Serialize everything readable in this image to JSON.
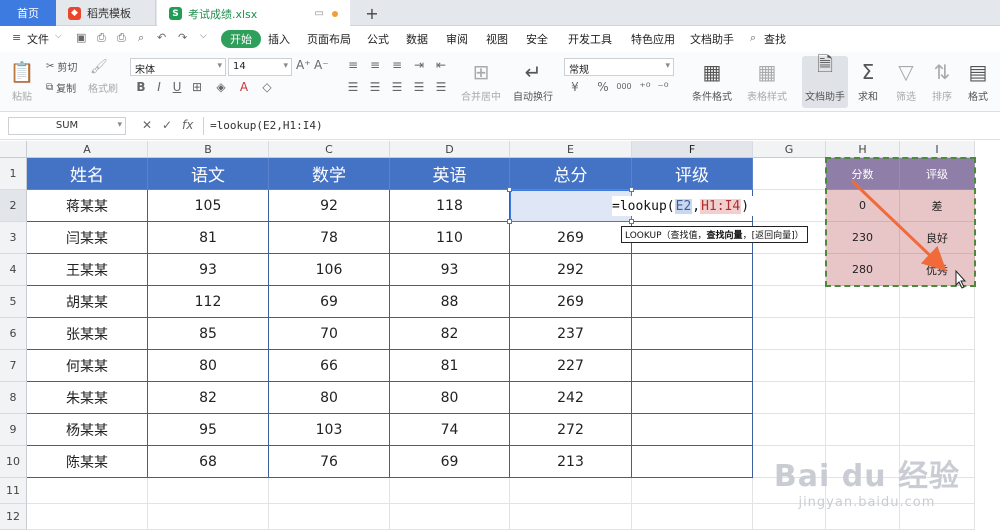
{
  "tabs": {
    "home": "首页",
    "template": "稻壳模板",
    "document": "考试成绩.xlsx"
  },
  "menu": {
    "file": "文件",
    "items": [
      "开始",
      "插入",
      "页面布局",
      "公式",
      "数据",
      "审阅",
      "视图",
      "安全",
      "开发工具",
      "特色应用",
      "文档助手"
    ],
    "search": "查找"
  },
  "ribbon": {
    "paste": "粘贴",
    "cut": "剪切",
    "copy": "复制",
    "format_painter": "格式刷",
    "font_name": "宋体",
    "font_size": "14",
    "merge_center": "合并居中",
    "wrap_text": "自动换行",
    "number_format": "常规",
    "conditional_format": "条件格式",
    "table_style": "表格样式",
    "doc_assistant": "文档助手",
    "sum": "求和",
    "filter": "筛选",
    "sort": "排序",
    "format": "格式",
    "percent": "%",
    "thousands": "000"
  },
  "formula_bar": {
    "name_box": "SUM",
    "cancel": "✕",
    "confirm": "✓",
    "fx": "fx",
    "formula": "=lookup(E2,H1:I4)"
  },
  "columns": [
    "A",
    "B",
    "C",
    "D",
    "E",
    "F",
    "G",
    "H",
    "I"
  ],
  "rows": [
    "1",
    "2",
    "3",
    "4",
    "5",
    "6",
    "7",
    "8",
    "9",
    "10",
    "11",
    "12"
  ],
  "table": {
    "headers": [
      "姓名",
      "语文",
      "数学",
      "英语",
      "总分",
      "评级"
    ],
    "rows": [
      [
        "蒋某某",
        "105",
        "92",
        "118",
        "",
        ""
      ],
      [
        "闫某某",
        "81",
        "78",
        "110",
        "269",
        ""
      ],
      [
        "王某某",
        "93",
        "106",
        "93",
        "292",
        ""
      ],
      [
        "胡某某",
        "112",
        "69",
        "88",
        "269",
        ""
      ],
      [
        "张某某",
        "85",
        "70",
        "82",
        "237",
        ""
      ],
      [
        "何某某",
        "80",
        "66",
        "81",
        "227",
        ""
      ],
      [
        "朱某某",
        "82",
        "80",
        "80",
        "242",
        ""
      ],
      [
        "杨某某",
        "95",
        "103",
        "74",
        "272",
        ""
      ],
      [
        "陈某某",
        "68",
        "76",
        "69",
        "213",
        ""
      ]
    ]
  },
  "lookup_table": {
    "headers": [
      "分数",
      "评级"
    ],
    "rows": [
      [
        "0",
        "差"
      ],
      [
        "230",
        "良好"
      ],
      [
        "280",
        "优秀"
      ]
    ]
  },
  "editing": {
    "prefix": "=lookup(",
    "arg1": "E2",
    "sep": ",",
    "arg2": "H1:I4",
    "suffix": ")"
  },
  "tooltip": {
    "func": "LOOKUP（查找值，",
    "bold": "查找向量",
    "rest": "，[返回向量]）"
  },
  "watermark": {
    "main": "Bai du 经验",
    "sub": "jingyan.baidu.com"
  },
  "colors": {
    "header_blue": "#4472c4",
    "lookup_header": "#8f7fa8",
    "lookup_cell": "#e8c5c7",
    "arrow": "#f06a3a",
    "start_green": "#2ea05b"
  }
}
